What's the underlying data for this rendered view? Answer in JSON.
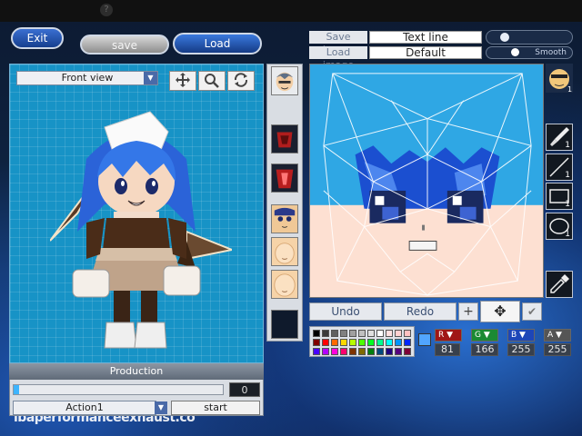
{
  "topbar": {
    "help_icon": "?"
  },
  "buttons": {
    "exit": "Exit",
    "save": "save",
    "load": "Load"
  },
  "view": {
    "select_value": "Front view"
  },
  "tools": {
    "move_icon": "move-arrows",
    "zoom_icon": "magnifier",
    "rotate_icon": "rotate-arrows"
  },
  "production": {
    "title": "Production",
    "value": "0",
    "progress": 0.0,
    "action": "Action1",
    "start": "start"
  },
  "image": {
    "save_label": "Save image",
    "load_label": "Load image",
    "text_line": "Text line",
    "font": "Default",
    "toggle2_text": "Smooth"
  },
  "right_tools": {
    "face_count": "1",
    "brush_count": "1",
    "line_count": "1",
    "rect_count": "1",
    "ellipse_count": "1"
  },
  "edit": {
    "undo": "Undo",
    "redo": "Redo"
  },
  "color": {
    "current": "#51A5FF",
    "r": "81",
    "g": "166",
    "b": "255",
    "a": "255"
  },
  "palette": [
    "#000000",
    "#3a3a3a",
    "#606060",
    "#808080",
    "#a0a0a0",
    "#c0c0c0",
    "#e0e0e0",
    "#ffffff",
    "#ffe0e0",
    "#ffd0d0",
    "#ffc0c0",
    "#800000",
    "#ff0000",
    "#ff6a00",
    "#ffd800",
    "#b6ff00",
    "#4cff00",
    "#00ff21",
    "#00ff90",
    "#00ffff",
    "#0094ff",
    "#0026ff",
    "#4800ff",
    "#b200ff",
    "#ff00dc",
    "#ff006e",
    "#7f3300",
    "#7f6a00",
    "#007f0e",
    "#00497f",
    "#21007f",
    "#57007f",
    "#7f0037"
  ],
  "bg_text": "lbaperformanceexhaust.co"
}
